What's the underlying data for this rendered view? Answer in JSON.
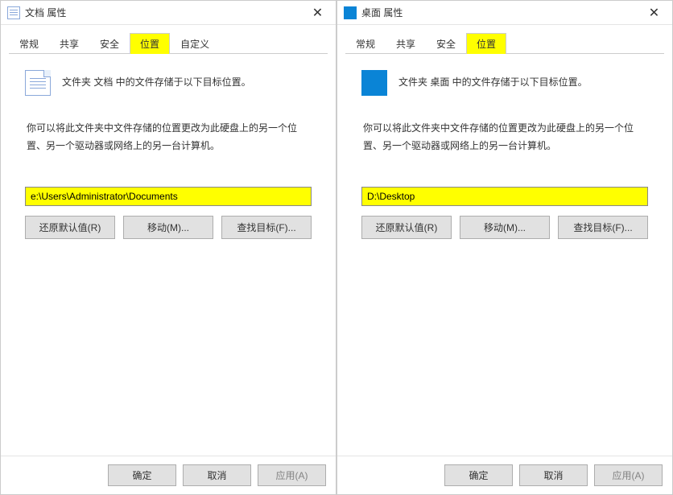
{
  "left": {
    "title": "文档 属性",
    "tabs": [
      "常规",
      "共享",
      "安全",
      "位置",
      "自定义"
    ],
    "active_tab_index": 3,
    "description": "文件夹 文档 中的文件存储于以下目标位置。",
    "instruction": "你可以将此文件夹中文件存储的位置更改为此硬盘上的另一个位置、另一个驱动器或网络上的另一台计算机。",
    "path": "e:\\Users\\Administrator\\Documents",
    "buttons": {
      "restore": "还原默认值(R)",
      "move": "移动(M)...",
      "find": "查找目标(F)..."
    },
    "bottom": {
      "ok": "确定",
      "cancel": "取消",
      "apply": "应用(A)"
    }
  },
  "right": {
    "title": "桌面 属性",
    "tabs": [
      "常规",
      "共享",
      "安全",
      "位置"
    ],
    "active_tab_index": 3,
    "description": "文件夹 桌面 中的文件存储于以下目标位置。",
    "instruction": "你可以将此文件夹中文件存储的位置更改为此硬盘上的另一个位置、另一个驱动器或网络上的另一台计算机。",
    "path": "D:\\Desktop",
    "buttons": {
      "restore": "还原默认值(R)",
      "move": "移动(M)...",
      "find": "查找目标(F)..."
    },
    "bottom": {
      "ok": "确定",
      "cancel": "取消",
      "apply": "应用(A)"
    }
  }
}
